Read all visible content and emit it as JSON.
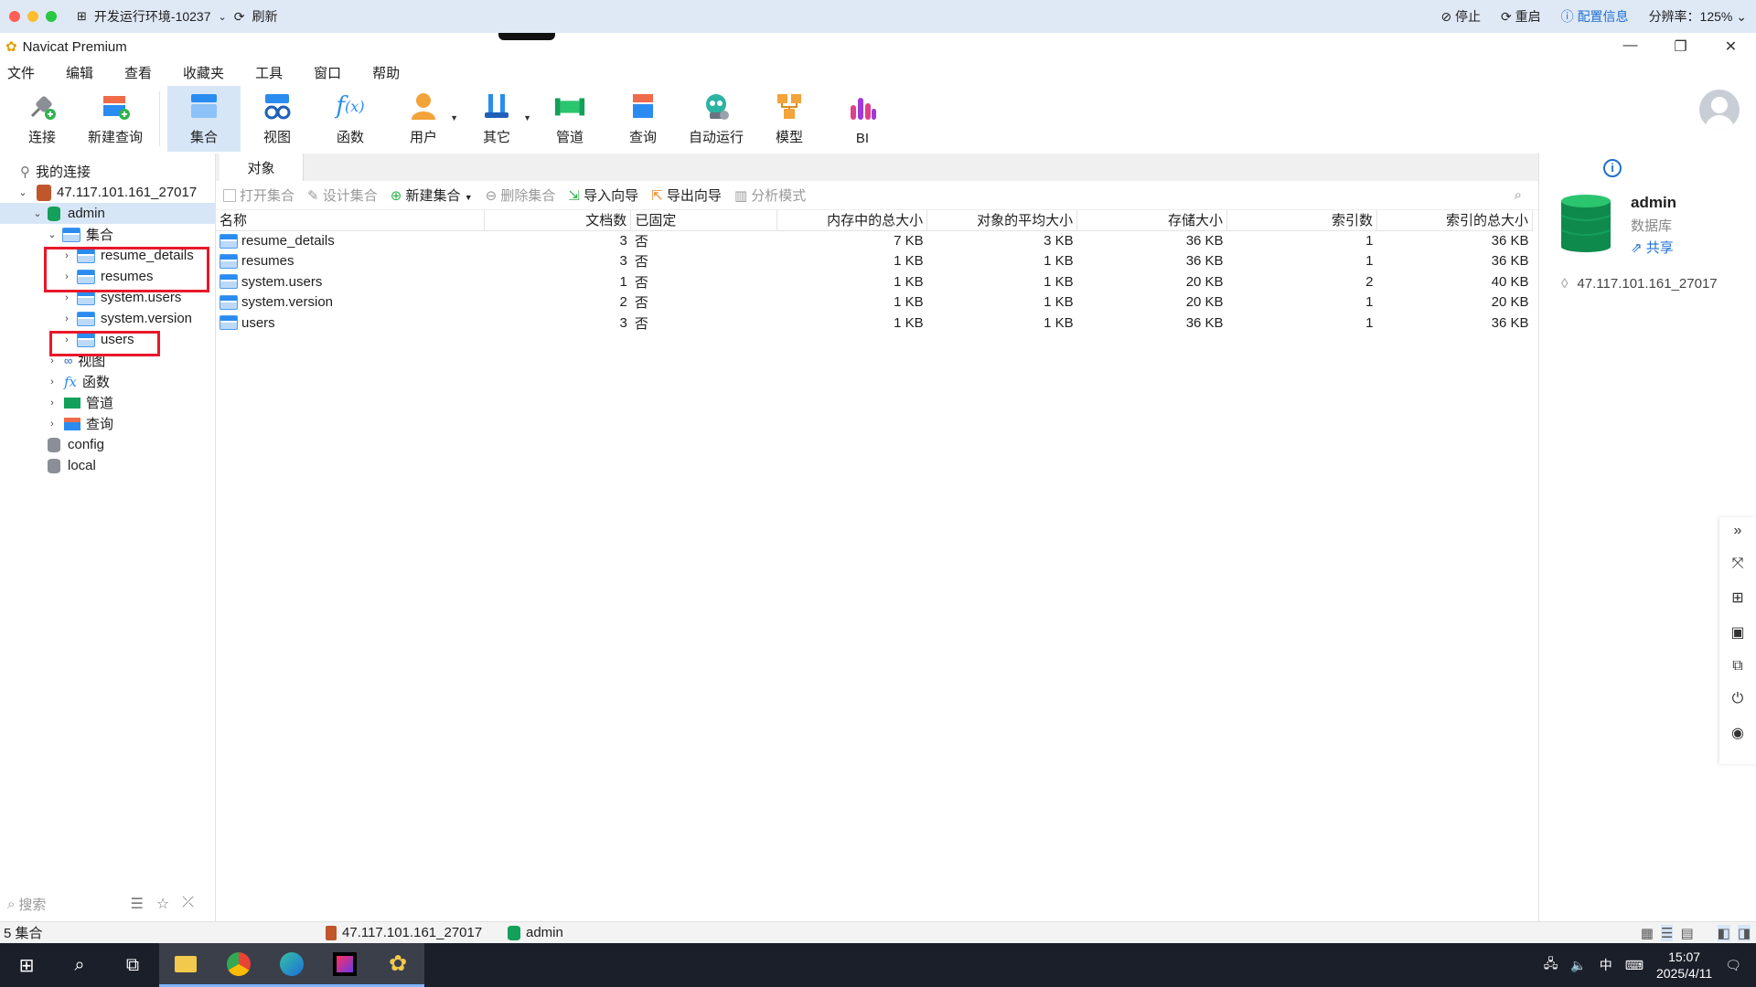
{
  "remote": {
    "env_label": "开发运行环境-10237",
    "refresh": "刷新",
    "stop": "停止",
    "restart": "重启",
    "config": "配置信息",
    "resolution": "分辨率：125%"
  },
  "app": {
    "title": "Navicat Premium"
  },
  "menu": [
    "文件",
    "编辑",
    "查看",
    "收藏夹",
    "工具",
    "窗口",
    "帮助"
  ],
  "toolbar": {
    "connect": "连接",
    "new_query": "新建查询",
    "collection": "集合",
    "view": "视图",
    "function": "函数",
    "user": "用户",
    "other": "其它",
    "pipeline": "管道",
    "query": "查询",
    "automation": "自动运行",
    "model": "模型",
    "bi": "BI"
  },
  "nav": {
    "my_connections": "我的连接",
    "server": "47.117.101.161_27017",
    "db_admin": "admin",
    "collections_group": "集合",
    "collections": [
      "resume_details",
      "resumes",
      "system.users",
      "system.version",
      "users"
    ],
    "views_group": "视图",
    "functions_group": "函数",
    "pipelines_group": "管道",
    "queries_group": "查询",
    "db_config": "config",
    "db_local": "local",
    "search_placeholder": "搜索"
  },
  "main": {
    "tab": "对象",
    "actions": {
      "open": "打开集合",
      "design": "设计集合",
      "new": "新建集合",
      "delete": "删除集合",
      "import": "导入向导",
      "export": "导出向导",
      "analyze": "分析模式"
    },
    "columns": [
      "名称",
      "文档数",
      "已固定",
      "内存中的总大小",
      "对象的平均大小",
      "存储大小",
      "索引数",
      "索引的总大小"
    ],
    "rows": [
      [
        "resume_details",
        "3",
        "否",
        "7 KB",
        "3 KB",
        "36 KB",
        "1",
        "36 KB"
      ],
      [
        "resumes",
        "3",
        "否",
        "1 KB",
        "1 KB",
        "36 KB",
        "1",
        "36 KB"
      ],
      [
        "system.users",
        "1",
        "否",
        "1 KB",
        "1 KB",
        "20 KB",
        "2",
        "40 KB"
      ],
      [
        "system.version",
        "2",
        "否",
        "1 KB",
        "1 KB",
        "20 KB",
        "1",
        "20 KB"
      ],
      [
        "users",
        "3",
        "否",
        "1 KB",
        "1 KB",
        "36 KB",
        "1",
        "36 KB"
      ]
    ]
  },
  "info": {
    "name": "admin",
    "type": "数据库",
    "share": "共享",
    "host": "47.117.101.161_27017"
  },
  "status": {
    "count": "5 集合",
    "connection": "47.117.101.161_27017",
    "database": "admin"
  },
  "taskbar": {
    "ime": "中",
    "time": "15:07",
    "date": "2025/4/11"
  },
  "colors": {
    "accent": "#1f6fd1",
    "selection": "#d7e6f7",
    "highlight_box": "#e8182a",
    "db_green": "#13a05a"
  }
}
